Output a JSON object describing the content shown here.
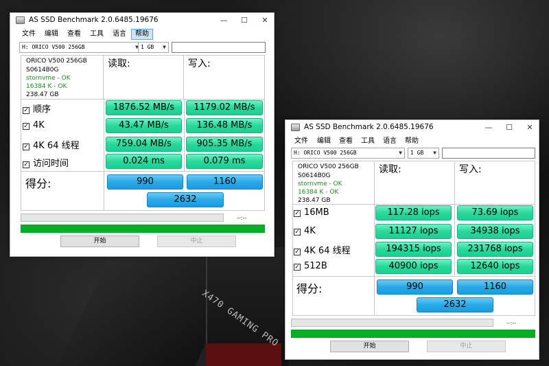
{
  "window1": {
    "title": "AS SSD Benchmark 2.0.6485.19676",
    "menu": [
      "文件",
      "编辑",
      "查看",
      "工具",
      "语言",
      "帮助"
    ],
    "drive": "H: ORICO V500 256GB",
    "size": "1 GB",
    "info": {
      "model": "ORICO V500 256GB",
      "firmware": "S0614B0G",
      "driver": "stornvme - OK",
      "align": "16384 K - OK",
      "capacity": "238.47 GB"
    },
    "read_header": "读取:",
    "write_header": "写入:",
    "rows": [
      {
        "label": "顺序",
        "read": "1876.52 MB/s",
        "write": "1179.02 MB/s"
      },
      {
        "label": "4K",
        "read": "43.47 MB/s",
        "write": "136.48 MB/s"
      },
      {
        "label": "4K 64 线程",
        "read": "759.04 MB/s",
        "write": "905.35 MB/s"
      },
      {
        "label": "访问时间",
        "read": "0.024 ms",
        "write": "0.079 ms"
      }
    ],
    "score_label": "得分:",
    "score_read": "990",
    "score_write": "1160",
    "score_total": "2632",
    "time": "--:--",
    "start": "开始",
    "stop": "中止"
  },
  "window2": {
    "title": "AS SSD Benchmark 2.0.6485.19676",
    "menu": [
      "文件",
      "编辑",
      "查看",
      "工具",
      "语言",
      "帮助"
    ],
    "drive": "H: ORICO V500 256GB",
    "size": "1 GB",
    "info": {
      "model": "ORICO V500 256GB",
      "firmware": "S0614B0G",
      "driver": "stornvme - OK",
      "align": "16384 K - OK",
      "capacity": "238.47 GB"
    },
    "read_header": "读取:",
    "write_header": "写入:",
    "rows": [
      {
        "label": "16MB",
        "read": "117.28 iops",
        "write": "73.69 iops"
      },
      {
        "label": "4K",
        "read": "11127 iops",
        "write": "34938 iops"
      },
      {
        "label": "4K 64 线程",
        "read": "194315 iops",
        "write": "231768 iops"
      },
      {
        "label": "512B",
        "read": "40900 iops",
        "write": "12640 iops"
      }
    ],
    "score_label": "得分:",
    "score_read": "990",
    "score_write": "1160",
    "score_total": "2632",
    "time": "--:--",
    "start": "开始",
    "stop": "中止"
  },
  "background_text": "X470 GAMING PRO",
  "colors": {
    "value_green": "#28d99c",
    "score_blue": "#2aa9e8",
    "progress_green": "#06b025",
    "ok_green": "#1f8a1f"
  },
  "icons": [
    "app-icon",
    "minimize-icon",
    "maximize-icon",
    "close-icon",
    "dropdown-arrow-icon",
    "checkbox-checked-icon"
  ]
}
